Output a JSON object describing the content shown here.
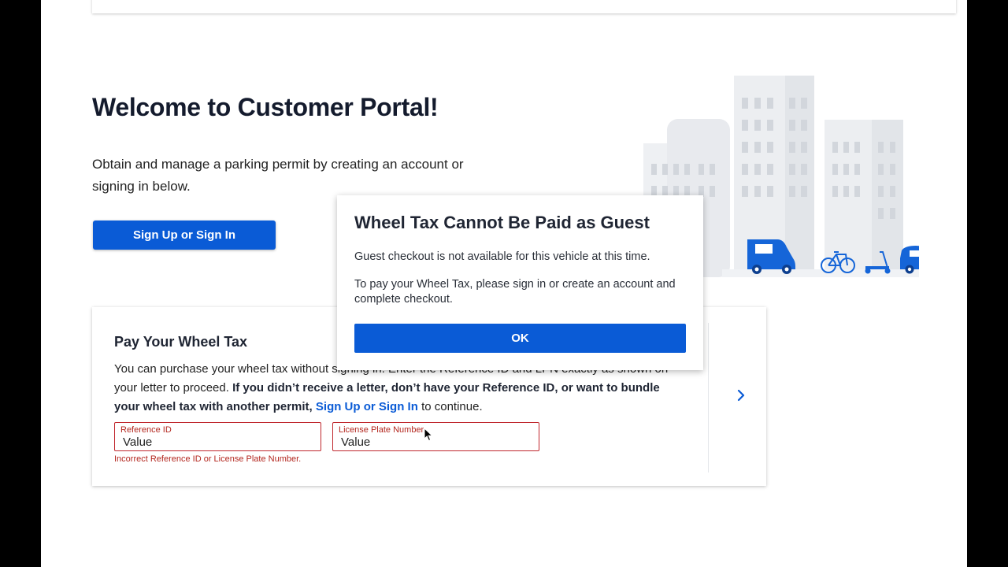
{
  "hero": {
    "title": "Welcome to Customer Portal!",
    "description": "Obtain and manage a parking permit by creating an account or signing in below.",
    "button_label": "Sign Up or Sign In"
  },
  "illustration": {
    "name": "city-transport-illustration",
    "vehicles": [
      "van-icon",
      "bicycle-icon",
      "scooter-icon",
      "car-icon"
    ]
  },
  "wheel_tax": {
    "title": "Pay Your Wheel Tax",
    "text_intro": "You can purchase your wheel tax without signing in. Enter the Reference ID and LPN exactly as shown on your letter to proceed.",
    "text_bold": "If you didn’t receive a letter, don’t have your Reference ID, or want to bundle your wheel tax with another permit,",
    "link_label": "Sign Up or Sign In",
    "text_end": "to continue.",
    "reference_field": {
      "label": "Reference ID",
      "value": "Value"
    },
    "plate_field": {
      "label": "License Plate Number",
      "value": "Value"
    },
    "error": "Incorrect Reference ID or License Plate Number."
  },
  "modal": {
    "title": "Wheel Tax Cannot Be Paid as Guest",
    "message1": "Guest checkout is not available for this vehicle at this time.",
    "message2": "To pay your Wheel Tax, please sign in or create an account and complete checkout.",
    "ok_label": "OK"
  },
  "colors": {
    "primary": "#0a5bd6",
    "error": "#b3261e",
    "heading": "#141b2d",
    "background": "#ffffff",
    "outer": "#000000"
  }
}
